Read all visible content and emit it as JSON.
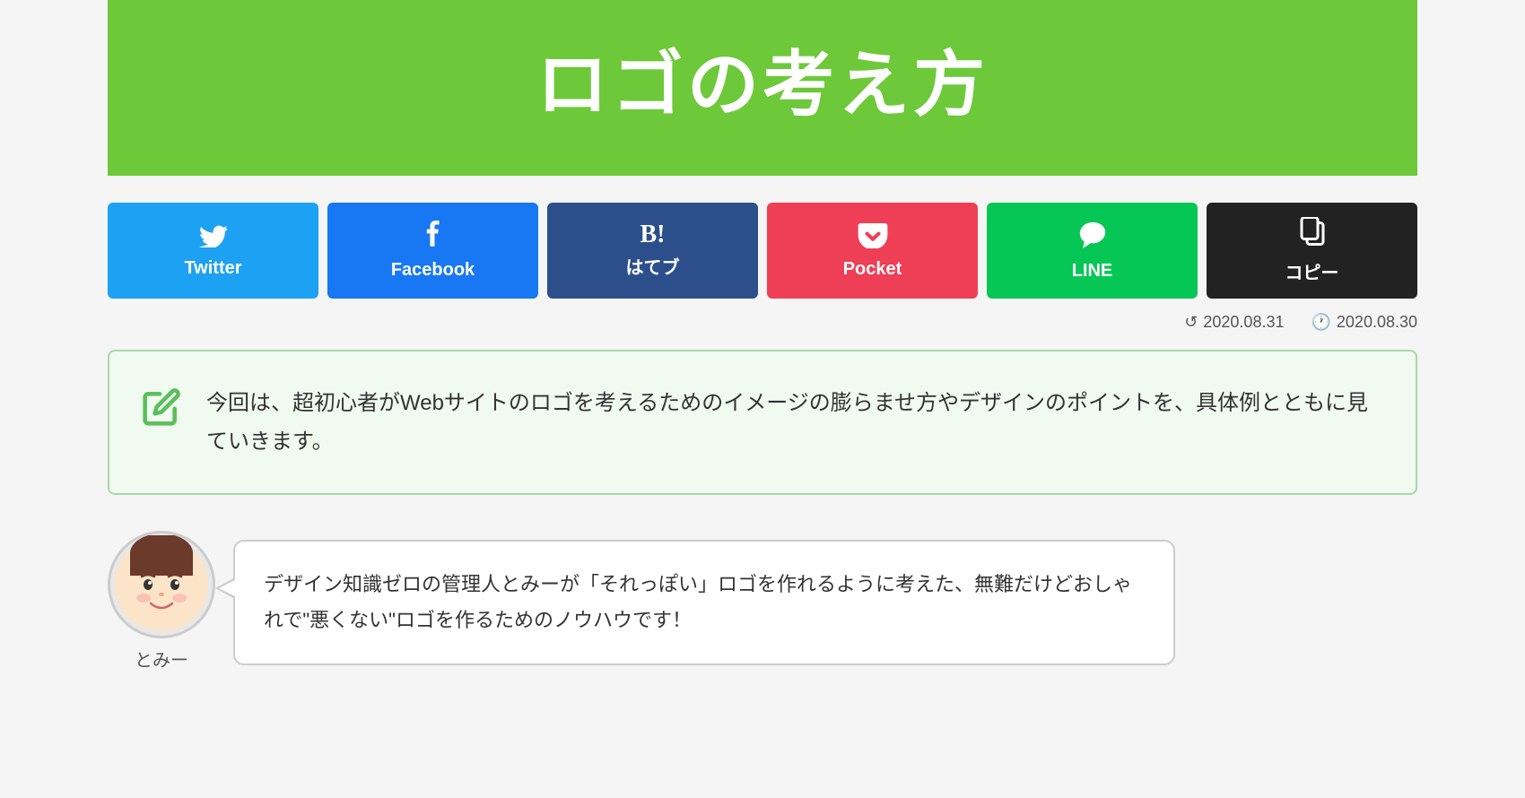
{
  "hero": {
    "title": "ロゴの考え方"
  },
  "shareButtons": [
    {
      "id": "twitter",
      "icon": "𝕏",
      "label": "Twitter",
      "class": "btn-twitter",
      "iconSymbol": "twitter"
    },
    {
      "id": "facebook",
      "icon": "f",
      "label": "Facebook",
      "class": "btn-facebook",
      "iconSymbol": "facebook"
    },
    {
      "id": "hatena",
      "icon": "B!",
      "label": "はてブ",
      "class": "btn-hatena",
      "iconSymbol": "hatena"
    },
    {
      "id": "pocket",
      "icon": "pocket",
      "label": "Pocket",
      "class": "btn-pocket",
      "iconSymbol": "pocket"
    },
    {
      "id": "line",
      "icon": "LINE",
      "label": "LINE",
      "class": "btn-line",
      "iconSymbol": "line"
    },
    {
      "id": "copy",
      "icon": "copy",
      "label": "コピー",
      "class": "btn-copy",
      "iconSymbol": "copy"
    }
  ],
  "dates": {
    "updated": "2020.08.31",
    "published": "2020.08.30",
    "updatedLabel": "2020.08.31",
    "publishedLabel": "2020.08.30"
  },
  "summary": {
    "text": "今回は、超初心者がWebサイトのロゴを考えるためのイメージの膨らませ方やデザインのポイントを、具体例とともに見ていきます。"
  },
  "character": {
    "name": "とみー",
    "speech": "デザイン知識ゼロの管理人とみーが「それっぽい」ロゴを作れるように考えた、無難だけどおしゃれで\"悪くない\"ロゴを作るためのノウハウです！"
  }
}
